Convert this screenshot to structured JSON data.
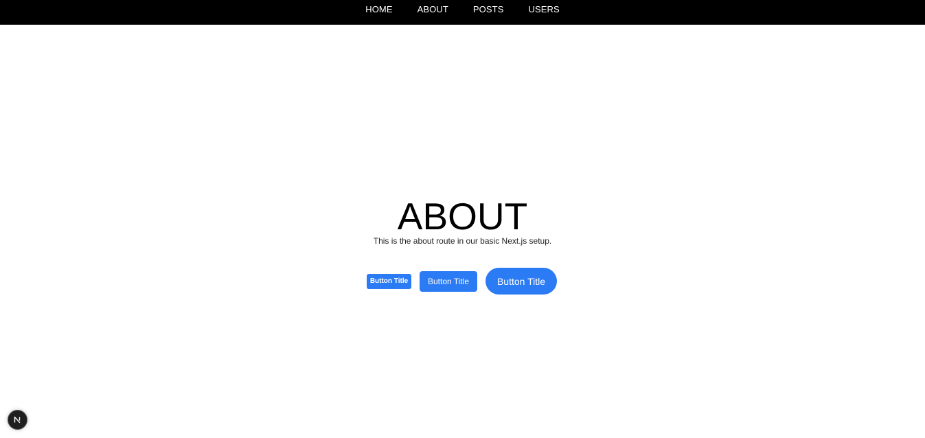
{
  "nav": {
    "items": [
      {
        "label": "HOME"
      },
      {
        "label": "ABOUT"
      },
      {
        "label": "POSTS"
      },
      {
        "label": "USERS"
      }
    ]
  },
  "main": {
    "title": "ABOUT",
    "subtitle": "This is the about route in our basic Next.js setup.",
    "buttons": [
      {
        "label": "Button Title",
        "size": "small"
      },
      {
        "label": "Button Title",
        "size": "medium"
      },
      {
        "label": "Button Title",
        "size": "large"
      }
    ]
  },
  "dev_badge": {
    "icon": "nextjs-logo-icon"
  },
  "colors": {
    "navbar_bg": "#000000",
    "button_accent": "#2b7bf5",
    "page_bg": "#ffffff"
  }
}
